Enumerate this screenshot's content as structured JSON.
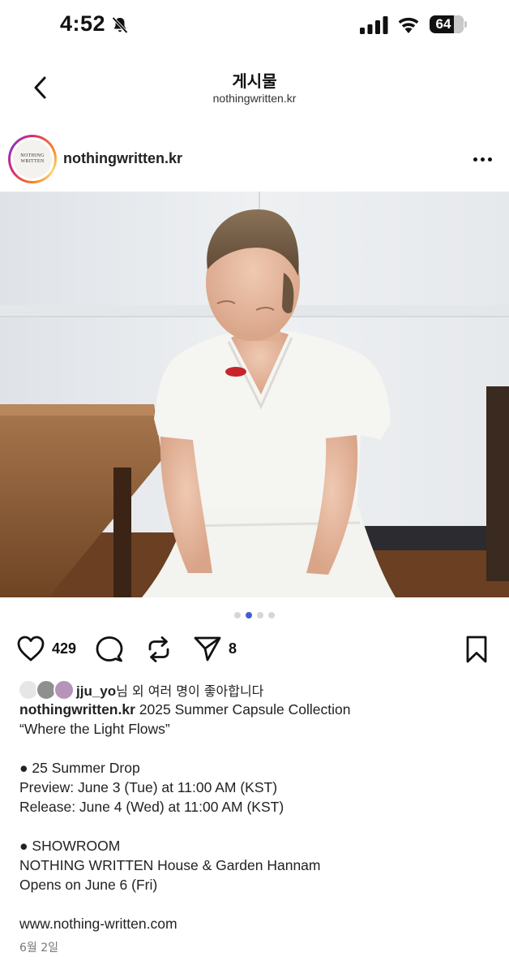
{
  "status_bar": {
    "time": "4:52",
    "battery": "64"
  },
  "header": {
    "title": "게시물",
    "subtitle": "nothingwritten.kr"
  },
  "post": {
    "username": "nothingwritten.kr",
    "avatar_logo_lines": [
      "NOTHING",
      "WRITTEN"
    ],
    "carousel": {
      "count": 4,
      "active_index": 1
    },
    "like_count": "429",
    "share_count": "8",
    "likes_user": "jju_yo",
    "likes_suffix": "님 외 여러 명이 좋아합니다",
    "caption_first": "2025 Summer Capsule Collection",
    "caption_lines": [
      "“Where the Light Flows”",
      "",
      "● 25 Summer Drop",
      "Preview: June 3 (Tue) at 11:00 AM (KST)",
      "Release: June 4 (Wed) at 11:00 AM (KST)",
      "",
      "● SHOWROOM",
      "NOTHING WRITTEN House & Garden Hannam",
      "Opens on June 6 (Fri)",
      "",
      "www.nothing-written.com"
    ],
    "date": "6월 2일"
  },
  "icons": {
    "back": "chevron-left-icon",
    "mute": "bell-slash-icon",
    "signal": "cellular-signal-icon",
    "wifi": "wifi-icon",
    "more": "ellipsis-icon",
    "like": "heart-icon",
    "comment": "comment-icon",
    "repost": "repost-icon",
    "share": "send-icon",
    "save": "bookmark-icon"
  },
  "colors": {
    "carousel_active": "#3f5fd6",
    "carousel_inactive": "#d6d6d6"
  }
}
